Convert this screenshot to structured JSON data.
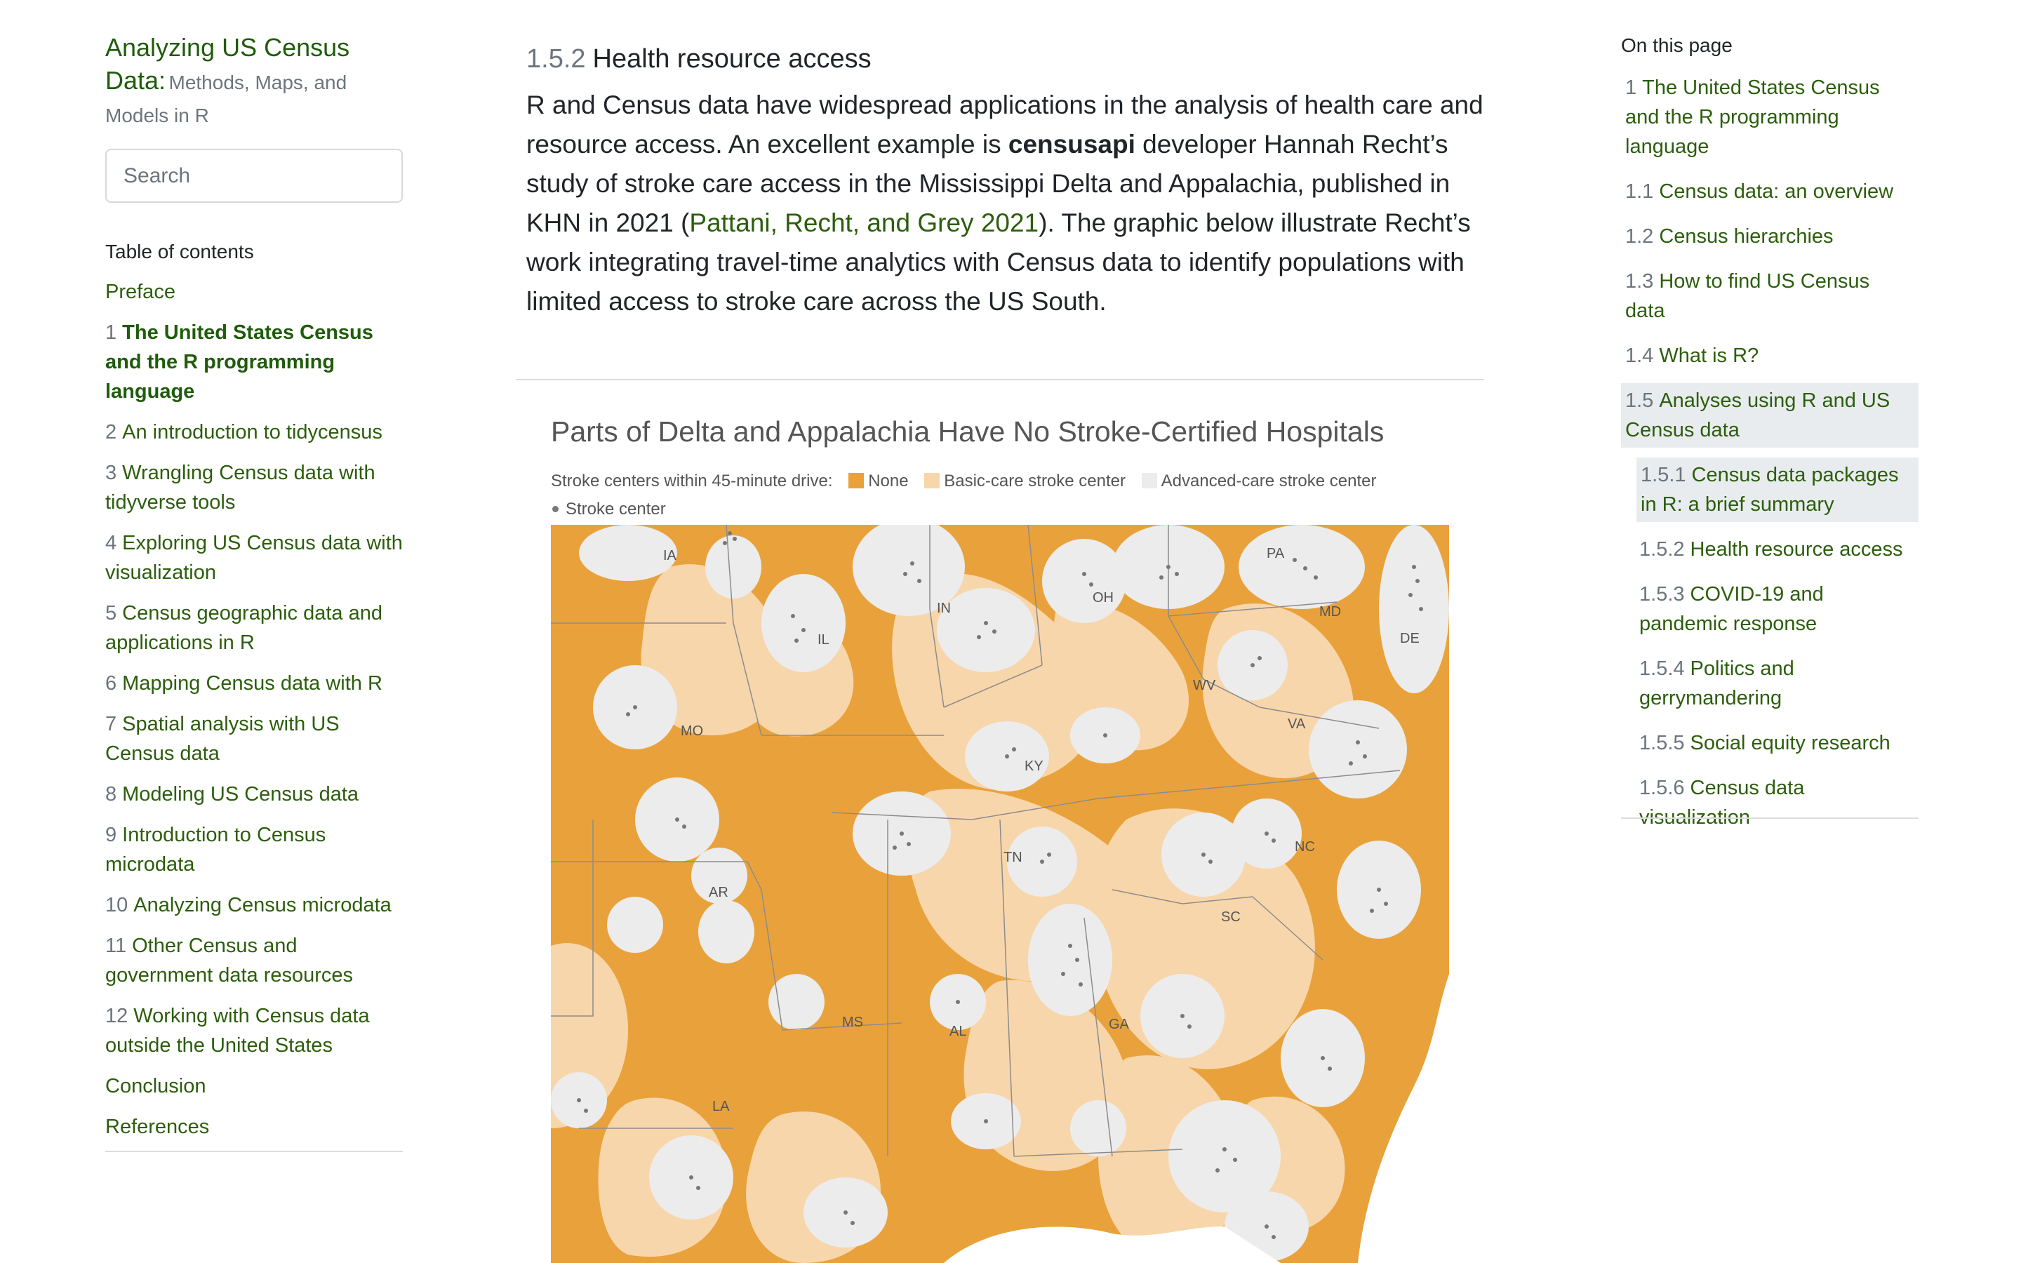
{
  "book": {
    "title_main": "Analyzing US Census Data:",
    "title_sub": "Methods, Maps, and Models in R"
  },
  "search": {
    "placeholder": "Search"
  },
  "left_toc": {
    "heading": "Table of contents",
    "items": [
      {
        "num": "",
        "label": "Preface"
      },
      {
        "num": "1",
        "label": "The United States Census and the R programming language"
      },
      {
        "num": "2",
        "label": "An introduction to tidycensus"
      },
      {
        "num": "3",
        "label": "Wrangling Census data with tidyverse tools"
      },
      {
        "num": "4",
        "label": "Exploring US Census data with visualization"
      },
      {
        "num": "5",
        "label": "Census geographic data and applications in R"
      },
      {
        "num": "6",
        "label": "Mapping Census data with R"
      },
      {
        "num": "7",
        "label": "Spatial analysis with US Census data"
      },
      {
        "num": "8",
        "label": "Modeling US Census data"
      },
      {
        "num": "9",
        "label": "Introduction to Census microdata"
      },
      {
        "num": "10",
        "label": "Analyzing Census microdata"
      },
      {
        "num": "11",
        "label": "Other Census and government data resources"
      },
      {
        "num": "12",
        "label": "Working with Census data outside the United States"
      },
      {
        "num": "",
        "label": "Conclusion"
      },
      {
        "num": "",
        "label": "References"
      }
    ]
  },
  "section": {
    "number": "1.5.2",
    "title": "Health resource access",
    "p_part1": "R and Census data have widespread applications in the analysis of health care and resource access. An excellent example is ",
    "p_bold": "censusapi",
    "p_part2": " developer Hannah Recht’s study of stroke care access in the Mississippi Delta and Appalachia, published in KHN in 2021 (",
    "p_link": "Pattani, Recht, and Grey 2021",
    "p_part3": "). The graphic below illustrate Recht’s work integrating travel-time analytics with Census data to identify populations with limited access to stroke care across the US South."
  },
  "figure": {
    "title": "Parts of Delta and Appalachia Have No Stroke-Certified Hospitals",
    "legend_prefix": "Stroke centers within 45-minute drive:",
    "legend_items": [
      {
        "label": "None",
        "color": "#e9a23b"
      },
      {
        "label": "Basic-care stroke center",
        "color": "#f8d6ab"
      },
      {
        "label": "Advanced-care stroke center",
        "color": "#ececec"
      }
    ],
    "stroke_center_label": "Stroke center",
    "state_labels": [
      "IA",
      "IN",
      "OH",
      "PA",
      "MD",
      "DE",
      "IL",
      "WV",
      "MO",
      "VA",
      "KY",
      "TN",
      "NC",
      "AR",
      "SC",
      "MS",
      "AL",
      "GA",
      "LA"
    ]
  },
  "right_toc": {
    "heading": "On this page",
    "items": [
      {
        "num": "1",
        "label": "The United States Census and the R programming language"
      },
      {
        "num": "1.1",
        "label": "Census data: an overview"
      },
      {
        "num": "1.2",
        "label": "Census hierarchies"
      },
      {
        "num": "1.3",
        "label": "How to find US Census data"
      },
      {
        "num": "1.4",
        "label": "What is R?"
      },
      {
        "num": "1.5",
        "label": "Analyses using R and US Census data"
      },
      {
        "num": "1.5.1",
        "label": "Census data packages in R: a brief summary"
      },
      {
        "num": "1.5.2",
        "label": "Health resource access"
      },
      {
        "num": "1.5.3",
        "label": "COVID-19 and pandemic response"
      },
      {
        "num": "1.5.4",
        "label": "Politics and gerrymandering"
      },
      {
        "num": "1.5.5",
        "label": "Social equity research"
      },
      {
        "num": "1.5.6",
        "label": "Census data visualization"
      }
    ]
  }
}
